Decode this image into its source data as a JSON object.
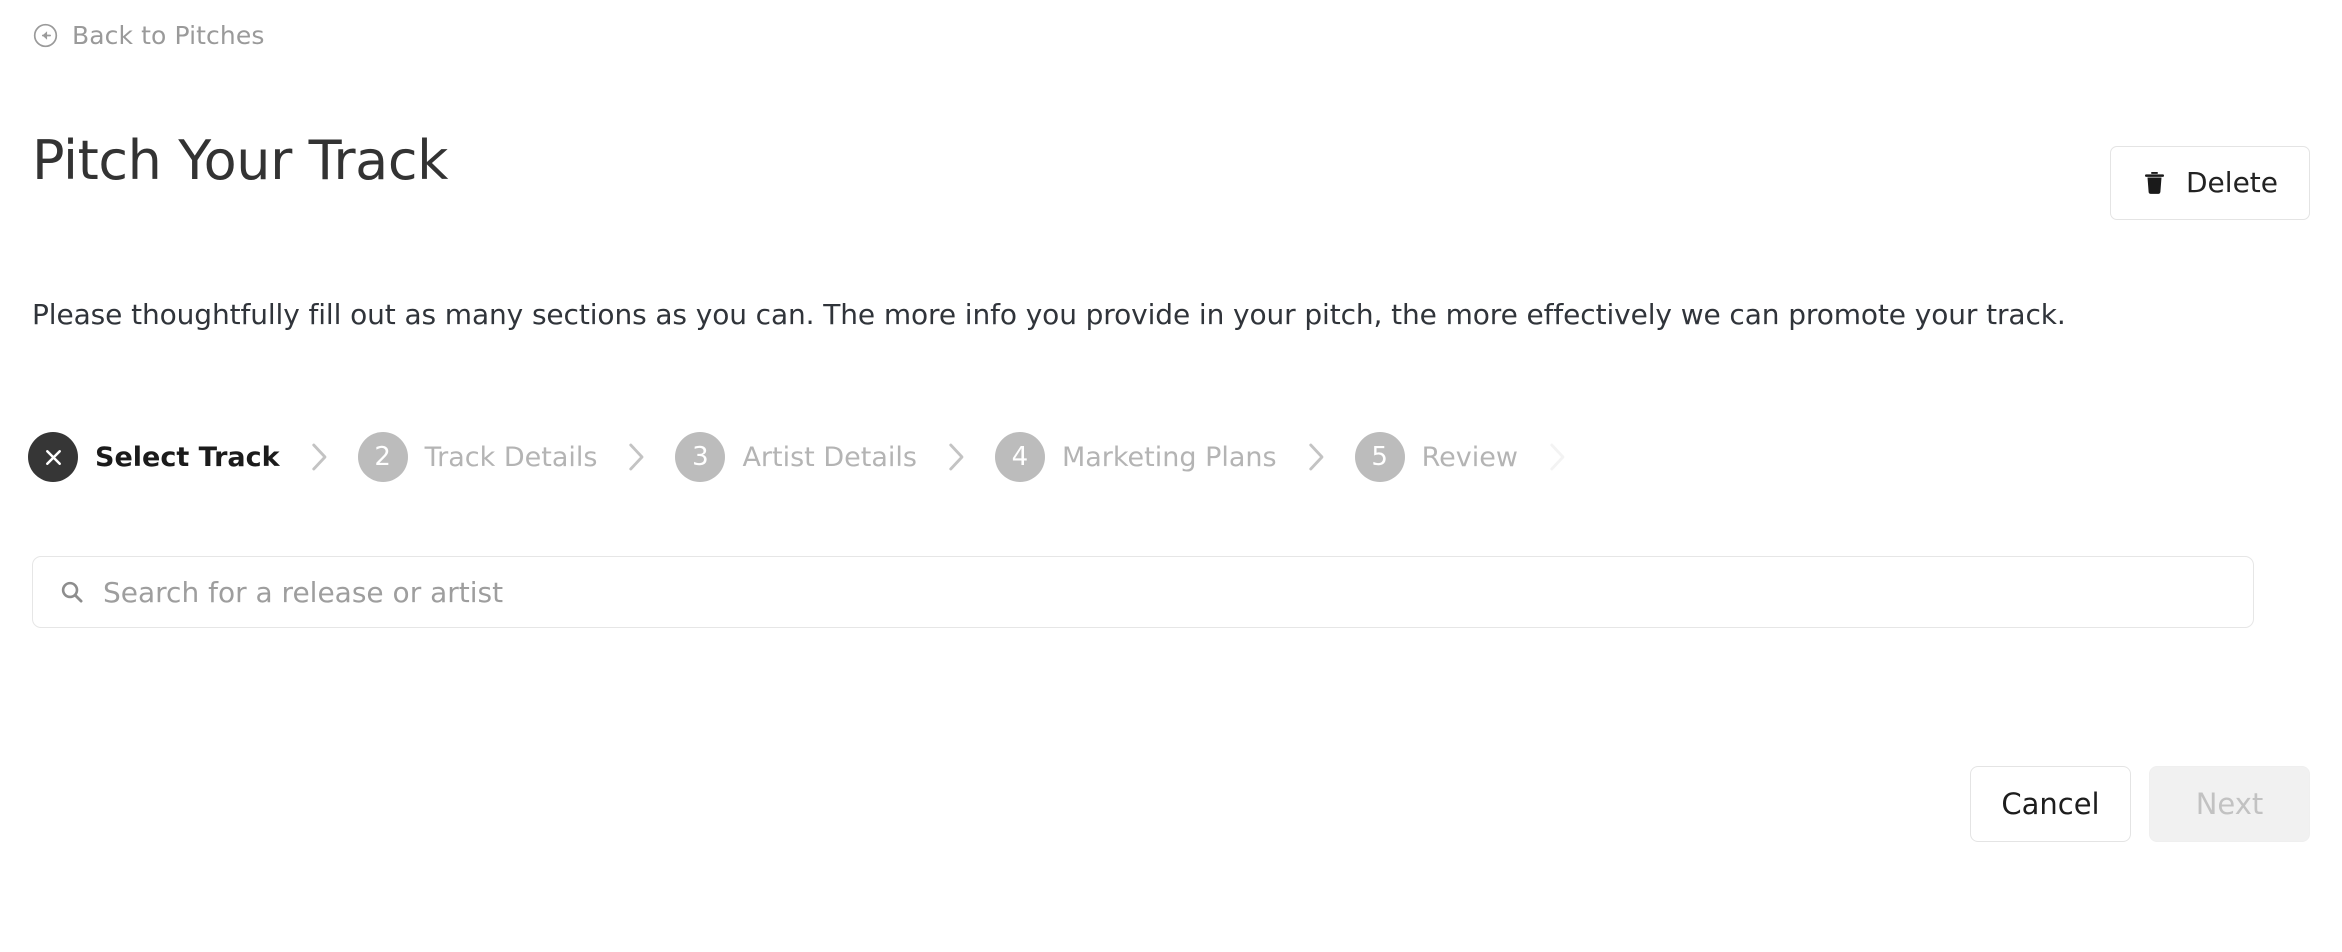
{
  "back": {
    "label": "Back to Pitches",
    "icon": "arrow-circle-left-icon"
  },
  "header": {
    "title": "Pitch Your Track",
    "delete_label": "Delete",
    "delete_icon": "trash-icon"
  },
  "description": "Please thoughtfully fill out as many sections as you can. The more info you provide in your pitch, the more effectively we can promote your track.",
  "stepper": {
    "steps": [
      {
        "marker": "✕",
        "label": "Select Track",
        "state": "active"
      },
      {
        "marker": "2",
        "label": "Track Details",
        "state": "inactive"
      },
      {
        "marker": "3",
        "label": "Artist Details",
        "state": "inactive"
      },
      {
        "marker": "4",
        "label": "Marketing Plans",
        "state": "inactive"
      },
      {
        "marker": "5",
        "label": "Review",
        "state": "inactive"
      }
    ],
    "separator_icon": "chevron-right-icon"
  },
  "search": {
    "placeholder": "Search for a release or artist",
    "value": "",
    "icon": "search-icon"
  },
  "footer": {
    "cancel_label": "Cancel",
    "next_label": "Next",
    "next_disabled": true
  },
  "colors": {
    "background": "#ffffff",
    "text_primary": "#2f2f2f",
    "text_muted": "#9a9a9a",
    "step_active_bg": "#363636",
    "step_inactive_bg": "#bcbcbc",
    "border": "#e4e4e4",
    "disabled_bg": "#f1f1f1"
  }
}
